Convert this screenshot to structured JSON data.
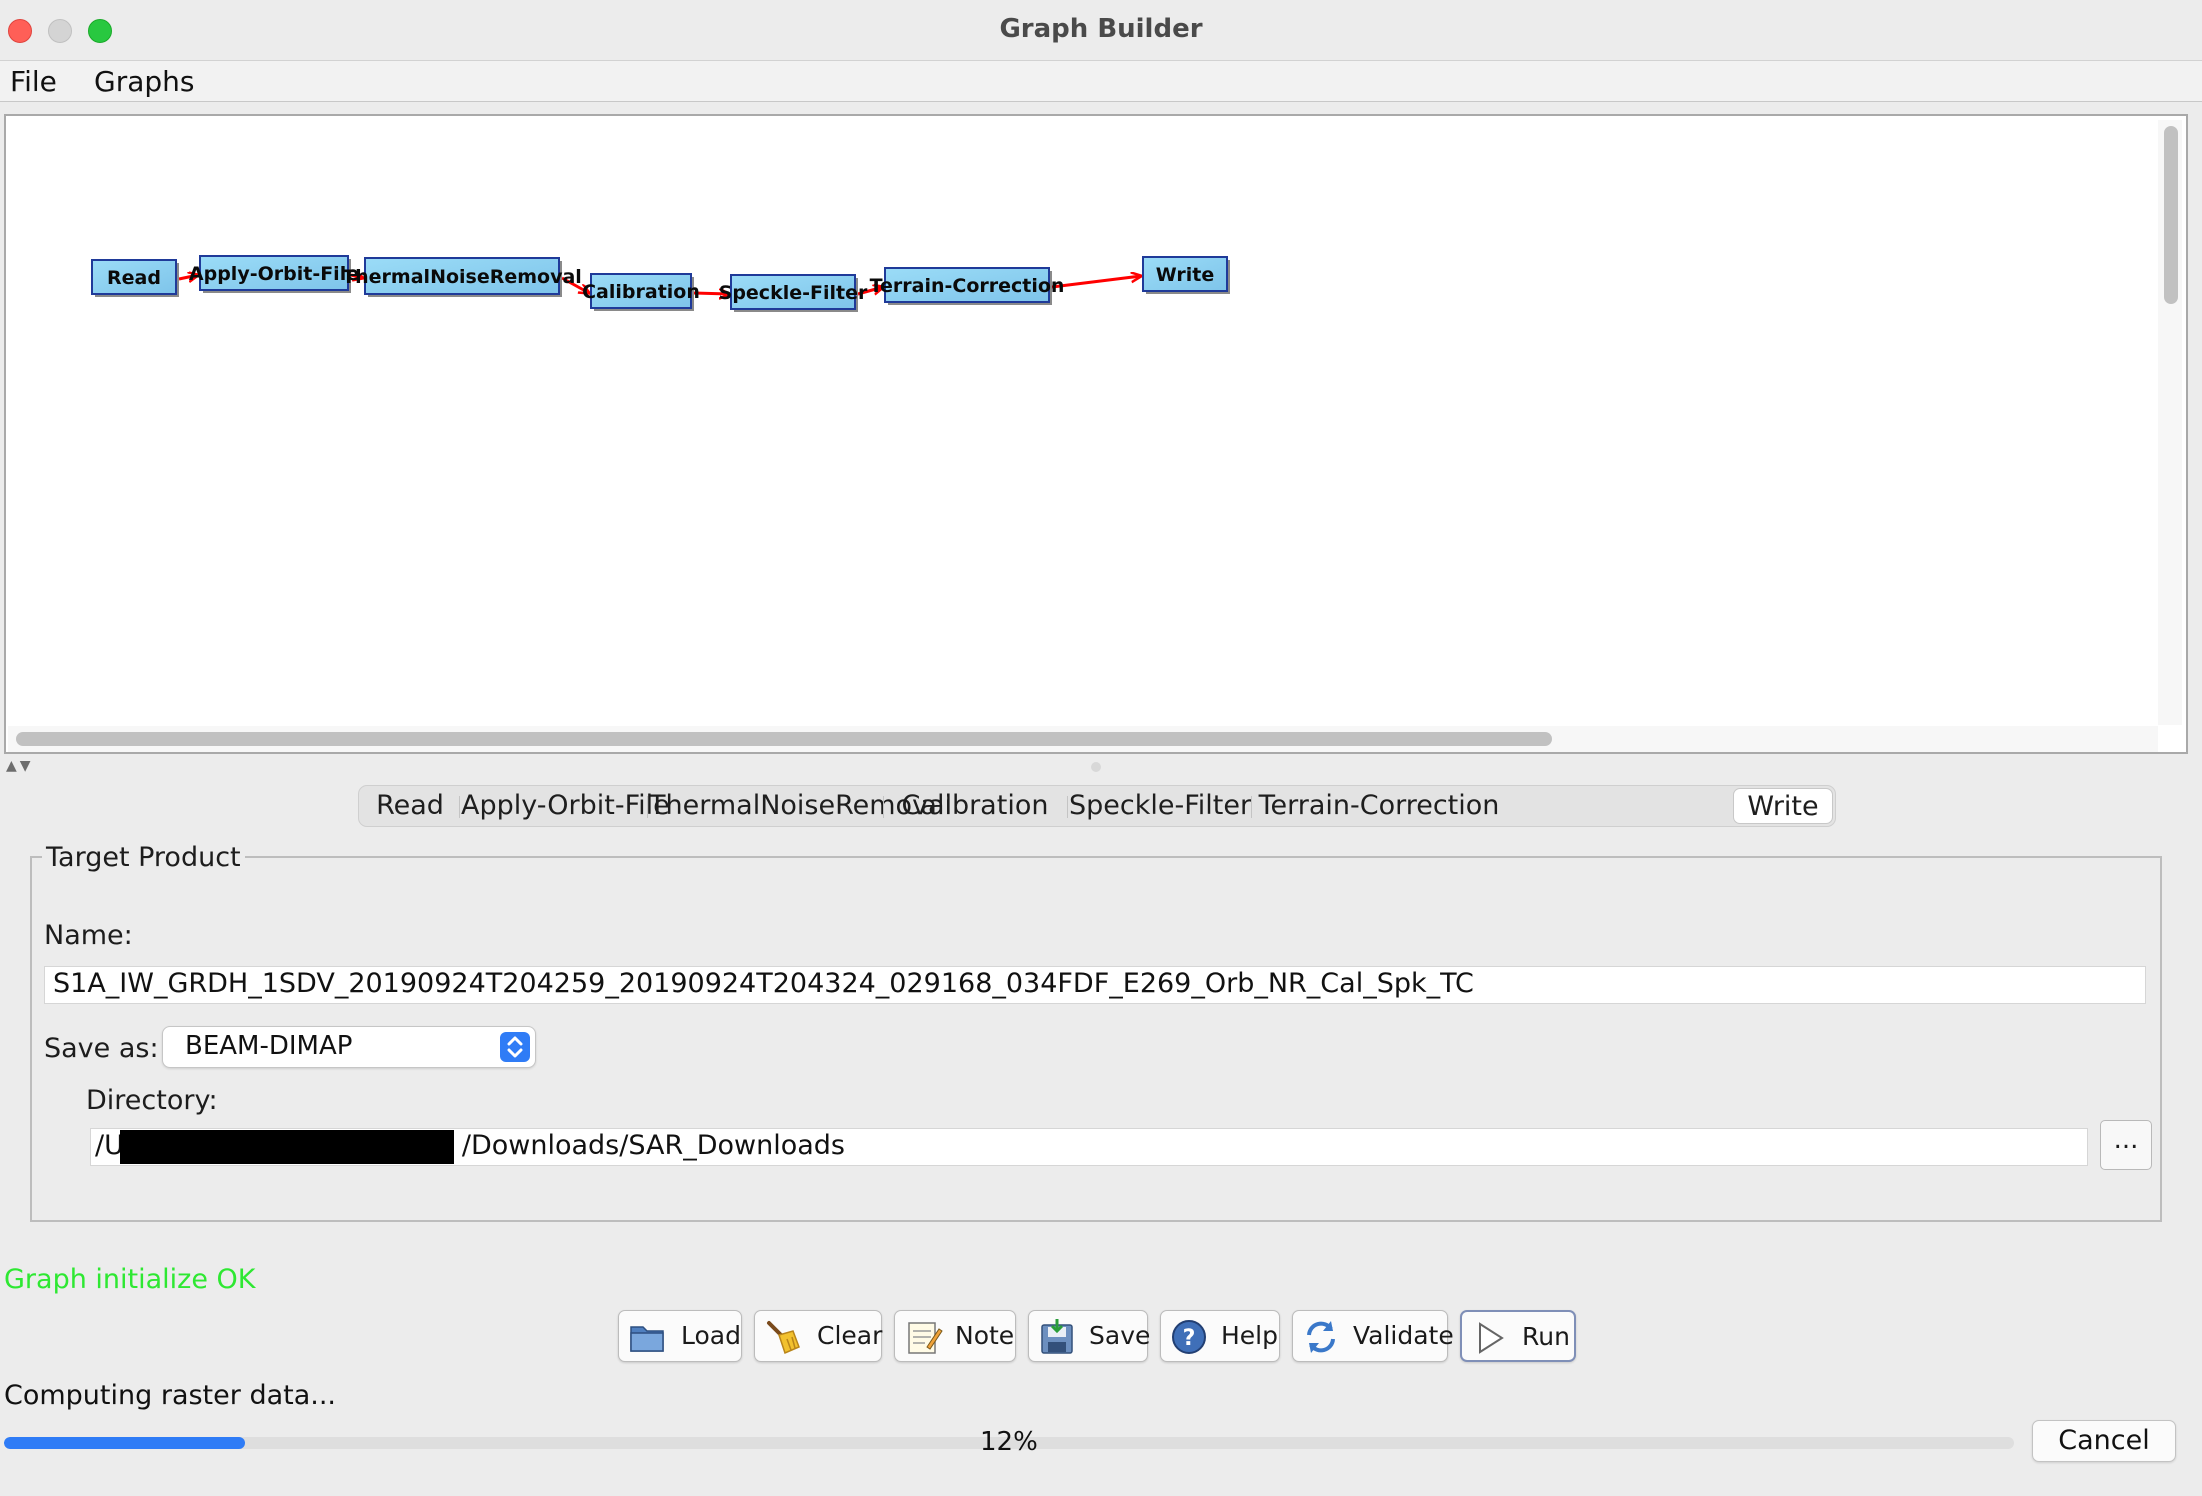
{
  "window": {
    "title": "Graph Builder"
  },
  "menu": [
    "File",
    "Graphs"
  ],
  "graph": {
    "nodes": [
      "Read",
      "Apply-Orbit-File",
      "ThermalNoiseRemoval",
      "Calibration",
      "Speckle-Filter",
      "Terrain-Correction",
      "Write"
    ],
    "node_color": "#87ceeb",
    "edge_color": "#ff0000"
  },
  "tabs": {
    "items": [
      "Read",
      "Apply-Orbit-File",
      "ThermalNoiseRemoval",
      "Calibration",
      "Speckle-Filter",
      "Terrain-Correction",
      "Write"
    ],
    "active": "Write"
  },
  "target_product": {
    "group_title": "Target Product",
    "name_label": "Name:",
    "name_value": "S1A_IW_GRDH_1SDV_20190924T204259_20190924T204324_029168_034FDF_E269_Orb_NR_Cal_Spk_TC",
    "save_as_label": "Save as:",
    "save_as_value": "BEAM-DIMAP",
    "directory_label": "Directory:",
    "directory_prefix": "/U",
    "directory_suffix": "/Downloads/SAR_Downloads",
    "browse_label": "..."
  },
  "status": {
    "message": "Graph initialize OK",
    "color": "#2ee832"
  },
  "buttons": {
    "load": "Load",
    "clear": "Clear",
    "note": "Note",
    "save": "Save",
    "help": "Help",
    "validate": "Validate",
    "run": "Run"
  },
  "progress": {
    "label": "Computing raster data...",
    "value": 0.12,
    "text": "12%",
    "cancel": "Cancel",
    "color": "#2f7cf6"
  }
}
